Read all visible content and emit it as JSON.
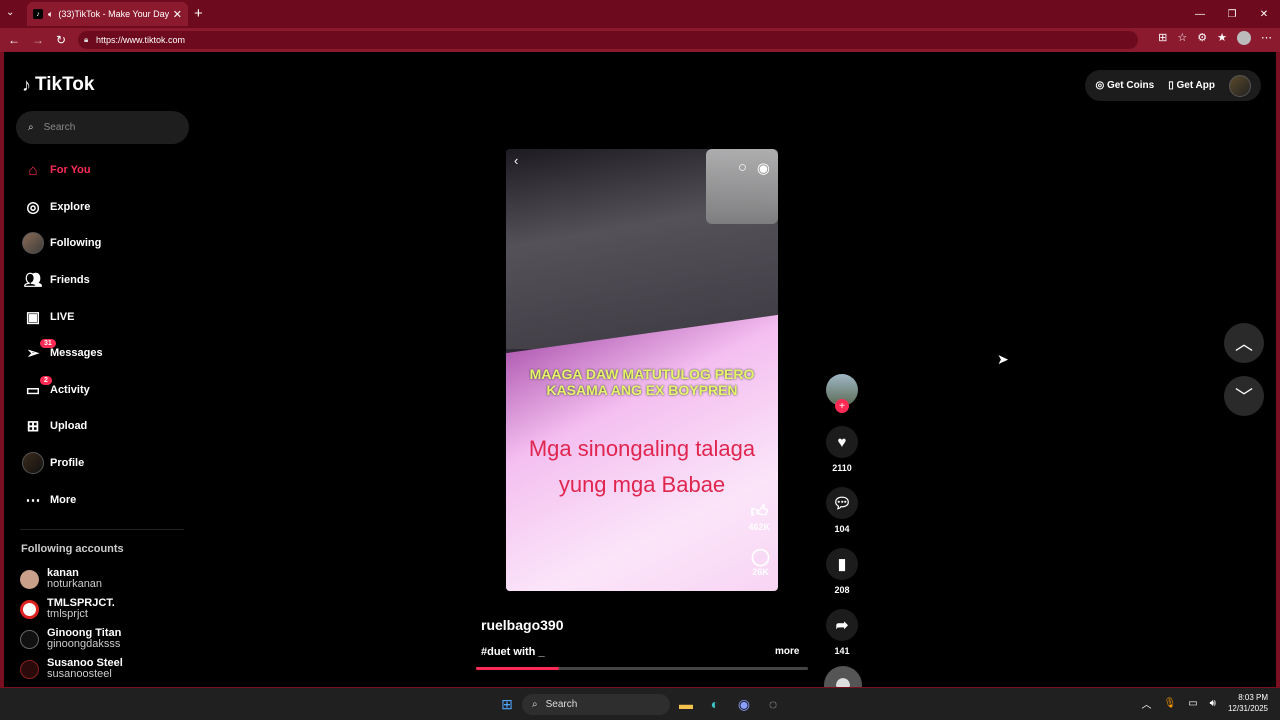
{
  "browser": {
    "tab_title": "(33)TikTok - Make Your Day",
    "url": "https://www.tiktok.com"
  },
  "sidebar": {
    "logo": "TikTok",
    "search_placeholder": "Search",
    "items": [
      {
        "label": "For You",
        "icon": "home-icon"
      },
      {
        "label": "Explore",
        "icon": "compass-icon"
      },
      {
        "label": "Following",
        "icon": "following-avatar"
      },
      {
        "label": "Friends",
        "icon": "friends-icon"
      },
      {
        "label": "LIVE",
        "icon": "live-icon"
      },
      {
        "label": "Messages",
        "icon": "messages-icon",
        "badge": "31"
      },
      {
        "label": "Activity",
        "icon": "activity-icon",
        "badge": "2"
      },
      {
        "label": "Upload",
        "icon": "upload-icon"
      },
      {
        "label": "Profile",
        "icon": "profile-avatar"
      },
      {
        "label": "More",
        "icon": "more-icon"
      }
    ],
    "following_title": "Following accounts",
    "following": [
      {
        "name": "kanan",
        "username": "noturkanan"
      },
      {
        "name": "TMLSPRJCT.",
        "username": "tmlsprjct"
      },
      {
        "name": "Ginoong Titan",
        "username": "ginoongdaksss"
      },
      {
        "name": "Susanoo Steel",
        "username": "susanoosteel"
      }
    ]
  },
  "header": {
    "get_coins": "Get Coins",
    "get_app": "Get App"
  },
  "video": {
    "caption_top": "MAAGA DAW MATUTULOG PERO KASAMA ANG EX BOYPREN",
    "caption_main": "Mga sinongaling talaga yung mga Babae",
    "inner_likes": "462K",
    "inner_comments": "26K",
    "username": "ruelbago390",
    "description": "#duet with _",
    "more_label": "more",
    "progress": 0.25
  },
  "actions": {
    "likes": "2110",
    "comments": "104",
    "saves": "208",
    "shares": "141"
  },
  "taskbar": {
    "search": "Search",
    "time": "8:03 PM",
    "date": "12/31/2025"
  }
}
